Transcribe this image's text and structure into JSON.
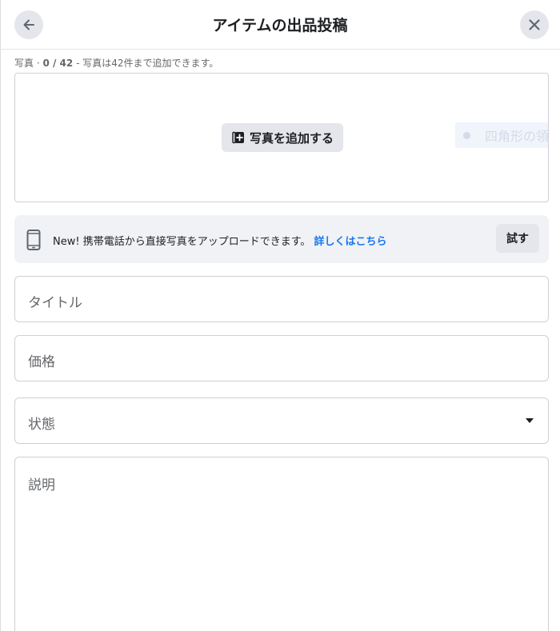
{
  "header": {
    "title": "アイテムの出品投稿",
    "back_icon": "arrow-left-icon",
    "close_icon": "close-icon"
  },
  "photos": {
    "label": "写真",
    "count": "0 / 42",
    "hint": "写真は42件まで追加できます。",
    "add_button": "写真を追加する",
    "ghost_tooltip": "四角形の領域"
  },
  "banner": {
    "text": "New! 携帯電話から直接写真をアップロードできます。",
    "link": "詳しくはこちら",
    "try_button": "試す"
  },
  "form": {
    "title_placeholder": "タイトル",
    "price_placeholder": "価格",
    "condition_placeholder": "状態",
    "description_placeholder": "説明"
  },
  "colors": {
    "link": "#1877f2",
    "button_bg": "#e4e6eb",
    "banner_bg": "#f0f2f5",
    "border": "#ced0d4"
  }
}
